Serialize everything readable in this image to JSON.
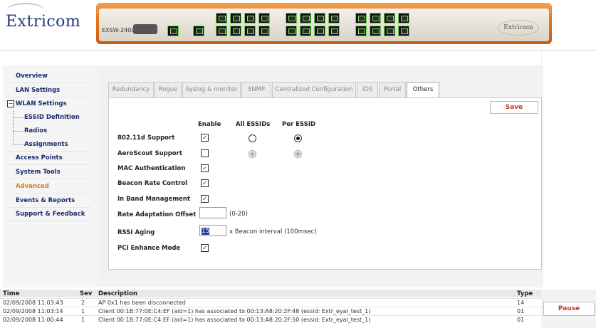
{
  "header": {
    "logo_text": "Extricom",
    "device_model": "EXSW-2400",
    "device_logo_text": "Extricom"
  },
  "nav": {
    "items": [
      {
        "label": "Overview"
      },
      {
        "label": "LAN Settings"
      },
      {
        "label": "WLAN Settings",
        "tree_toggle": "−"
      },
      {
        "label": "ESSID Definition"
      },
      {
        "label": "Radios"
      },
      {
        "label": "Assignments"
      },
      {
        "label": "Access Points"
      },
      {
        "label": "System Tools"
      },
      {
        "label": "Advanced",
        "active": true
      },
      {
        "label": "Events & Reports"
      },
      {
        "label": "Support & Feedback"
      }
    ]
  },
  "tabs": [
    {
      "label": "Redundancy"
    },
    {
      "label": "Rogue"
    },
    {
      "label": "Syslog & monitor"
    },
    {
      "label": "SNMP"
    },
    {
      "label": "Centralized Configuration"
    },
    {
      "label": "IDS"
    },
    {
      "label": "Portal"
    },
    {
      "label": "Others",
      "active": true
    }
  ],
  "panel": {
    "save_label": "Save",
    "columns": {
      "enable": "Enable",
      "all_essids": "All ESSIDs",
      "per_essid": "Per ESSID"
    },
    "rows": {
      "r80211d": {
        "label": "802.11d Support",
        "checked": "✓"
      },
      "aeroscout": {
        "label": "AeroScout Support",
        "checked": ""
      },
      "mac_auth": {
        "label": "MAC Authentication",
        "checked": "✓"
      },
      "beacon_rate": {
        "label": "Beacon Rate Control",
        "checked": "✓"
      },
      "inband": {
        "label": "In Band Management",
        "checked": "✓"
      },
      "rate_adapt": {
        "label": "Rate Adaptation Offset",
        "value": "",
        "hint": "(0-20)"
      },
      "rssi": {
        "label": "RSSI Aging",
        "value": "15",
        "hint": "x Beacon interval (100msec)"
      },
      "pci": {
        "label": "PCI Enhance Mode",
        "checked": "✓"
      }
    }
  },
  "log": {
    "headers": {
      "time": "Time",
      "sev": "Sev",
      "desc": "Description",
      "type": "Type"
    },
    "rows": [
      {
        "time": "02/09/2008 11:03:43",
        "sev": "2",
        "desc": "AP 0x1 has been disconnected",
        "type": "14"
      },
      {
        "time": "02/09/2008 11:03:14",
        "sev": "1",
        "desc": "Client 00:1B:77:0E:C4:EF (aid=1) has associated to 00:13:A8:20:2F:48 (essid: Extr_eyal_test_1)",
        "type": "01"
      },
      {
        "time": "02/09/2008 11:00:44",
        "sev": "1",
        "desc": "Client 00:1B:77:0E:C4:EF (aid=1) has associated to 00:13:A8:20:2F:50 (essid: Extr_eyal_test_1)",
        "type": "01"
      }
    ],
    "pause_label": "Pause"
  },
  "colors": {
    "accent": "#e07a22",
    "nav_text": "#1b2a6e",
    "button_text": "#c0392b"
  }
}
